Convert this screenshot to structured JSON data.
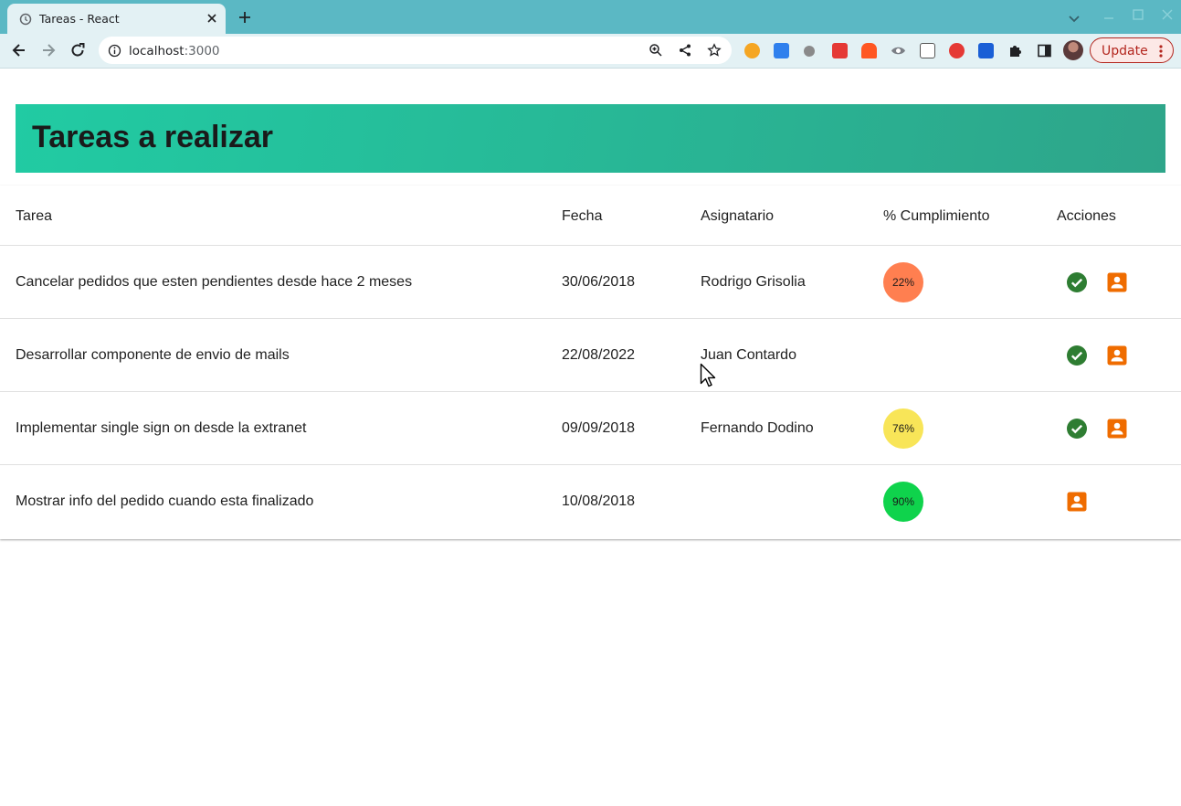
{
  "browser": {
    "tab_title": "Tareas - React",
    "url_host": "localhost",
    "url_port": ":3000",
    "update_label": "Update"
  },
  "page": {
    "title": "Tareas a realizar",
    "columns": [
      "Tarea",
      "Fecha",
      "Asignatario",
      "% Cumplimiento",
      "Acciones"
    ],
    "rows": [
      {
        "tarea": "Cancelar pedidos que esten pendientes desde hace 2 meses",
        "fecha": "30/06/2018",
        "asignatario": "Rodrigo Grisolia",
        "cumplimiento": "22%",
        "badge_color": "#ff7f50",
        "actions": [
          "check-circle-icon",
          "person-icon"
        ]
      },
      {
        "tarea": "Desarrollar componente de envio de mails",
        "fecha": "22/08/2022",
        "asignatario": "Juan Contardo",
        "cumplimiento": "",
        "badge_color": "",
        "actions": [
          "check-circle-icon",
          "person-icon"
        ]
      },
      {
        "tarea": "Implementar single sign on desde la extranet",
        "fecha": "09/09/2018",
        "asignatario": "Fernando Dodino",
        "cumplimiento": "76%",
        "badge_color": "#f8e558",
        "actions": [
          "check-circle-icon",
          "person-icon"
        ]
      },
      {
        "tarea": "Mostrar info del pedido cuando esta finalizado",
        "fecha": "10/08/2018",
        "asignatario": "",
        "cumplimiento": "90%",
        "badge_color": "#0fd34c",
        "actions": [
          "person-icon"
        ]
      }
    ]
  },
  "colors": {
    "header_gradient_start": "#21cba3",
    "header_gradient_end": "#2ea58a",
    "check_icon": "#2e7d32",
    "person_icon": "#ef6c00"
  }
}
